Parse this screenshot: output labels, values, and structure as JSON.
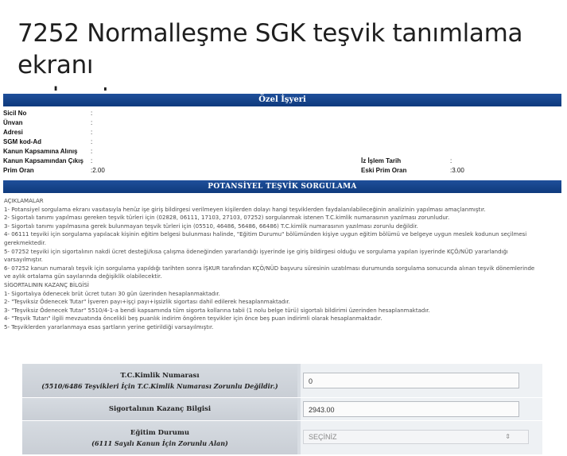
{
  "headline": {
    "line1": "7252 Normalleşme SGK teşvik tanımlama ekranı",
    "line2": "açılmıştır."
  },
  "employer_section": {
    "title": "Özel İşyeri",
    "rows": [
      {
        "label": "Sicil No",
        "value": ":"
      },
      {
        "label": "Ünvan",
        "value": ":"
      },
      {
        "label": "Adresi",
        "value": ":"
      },
      {
        "label": "SGM kod-Ad",
        "value": ":"
      },
      {
        "label": "Kanun Kapsamına Alınış",
        "value": ":"
      },
      {
        "label": "Kanun Kapsamından Çıkış",
        "value": ":"
      },
      {
        "label": "Prim Oran",
        "value": ":2.00"
      }
    ],
    "right_rows": [
      {
        "label": "İz İşlem Tarih",
        "value": ":"
      },
      {
        "label": "Eski Prim Oran",
        "value": ":3.00"
      }
    ]
  },
  "inquiry_section": {
    "title": "POTANSİYEL TEŞVİK SORGULAMA"
  },
  "notes": [
    "AÇIKLAMALAR",
    "1- Potansiyel sorgulama ekranı vasıtasıyla henüz işe giriş bildirgesi verilmeyen kişilerden dolayı hangi teşviklerden faydalanılabileceğinin analizinin yapılması amaçlanmıştır.",
    "2- Sigortalı tanımı yapılması gereken teşvik türleri için (02828, 06111, 17103, 27103, 07252) sorgulanmak istenen T.C.kimlik numarasının yazılması zorunludur.",
    "3- Sigortalı tanımı yapılmasına gerek bulunmayan teşvik türleri için (05510, 46486, 56486, 66486) T.C.kimlik numarasının yazılması zorunlu değildir.",
    "4- 06111 teşviki için sorgulama yapılacak kişinin eğitim belgesi bulunması halinde, \"Eğitim Durumu\" bölümünden kişiye uygun eğitim bölümü ve belgeye uygun meslek kodunun seçilmesi",
    "gerekmektedir.",
    "5- 07252 teşviki için sigortalının nakdi ücret desteği/kısa çalışma ödeneğinden yararlandığı işyerinde işe giriş bildirgesi olduğu ve sorgulama yapılan işyerinde KÇÖ/NÜD yararlandığı",
    "varsayılmıştır.",
    "6- 07252 kanun numaralı teşvik için sorgulama yapıldığı tarihten sonra İŞKUR tarafından KÇÖ/NÜD başvuru süresinin uzatılması durumunda sorgulama sonucunda alınan teşvik dönemlerinde",
    "ve aylık ortalama gün sayılarında değişiklik olabilecektir.",
    "SİGORTALININ KAZANÇ BİLGİSİ",
    "1- Sigortalıya ödenecek brüt ücret tutarı 30 gün üzerinden hesaplanmaktadır.",
    "2- \"Teşviksiz Ödenecek Tutar\" İşveren payı+işçi payı+işsizlik sigortası dahil edilerek hesaplanmaktadır.",
    "3- \"Teşviksiz Ödenecek Tutar\" 5510/4-1-a bendi kapsamında tüm sigorta kollarına tabii (1 nolu belge türü) sigortalı bildirimi üzerinden hesaplanmaktadır.",
    "4- \"Teşvik Tutarı\" ilgili mevzuatında öncelikli beş puanlık indirim öngören teşvikler için önce beş puan indirimli olarak hesaplanmaktadır.",
    "5- Teşviklerden yararlanmaya esas şartların yerine getirildiği varsayılmıştır."
  ],
  "form": {
    "tc_label": "T.C.Kimlik Numarası",
    "tc_sub": "(5510/6486 Teşvikleri İçin T.C.Kimlik Numarası Zorunlu Değildir.)",
    "tc_value": "0",
    "salary_label": "Sigortalının Kazanç Bilgisi",
    "salary_value": "2943.00",
    "education_label": "Eğitim Durumu",
    "education_sub": "(6111 Sayılı Kanun İçin Zorunlu Alan)",
    "education_selected": "SEÇİNİZ",
    "education_arrow": "⇕"
  },
  "colors": {
    "header_bar": "#1f4f9a",
    "form_label_bg": "#d6dbe1"
  }
}
